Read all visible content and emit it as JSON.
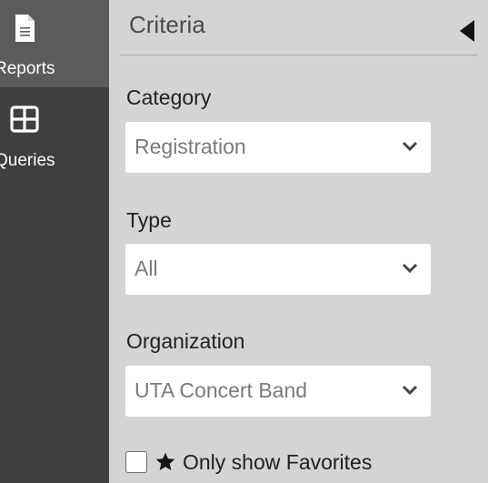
{
  "nav": {
    "items": [
      {
        "label": "Reports",
        "icon": "document-icon",
        "active": true
      },
      {
        "label": "Queries",
        "icon": "grid-icon",
        "active": false
      }
    ]
  },
  "panel": {
    "title": "Criteria",
    "fields": [
      {
        "label": "Category",
        "value": "Registration"
      },
      {
        "label": "Type",
        "value": "All"
      },
      {
        "label": "Organization",
        "value": "UTA Concert Band"
      }
    ],
    "favorites_label": "Only show Favorites"
  },
  "colors": {
    "nav_bg": "#3f3f3f",
    "nav_active_bg": "#5b5b5b",
    "panel_bg": "#d4d4d4"
  }
}
